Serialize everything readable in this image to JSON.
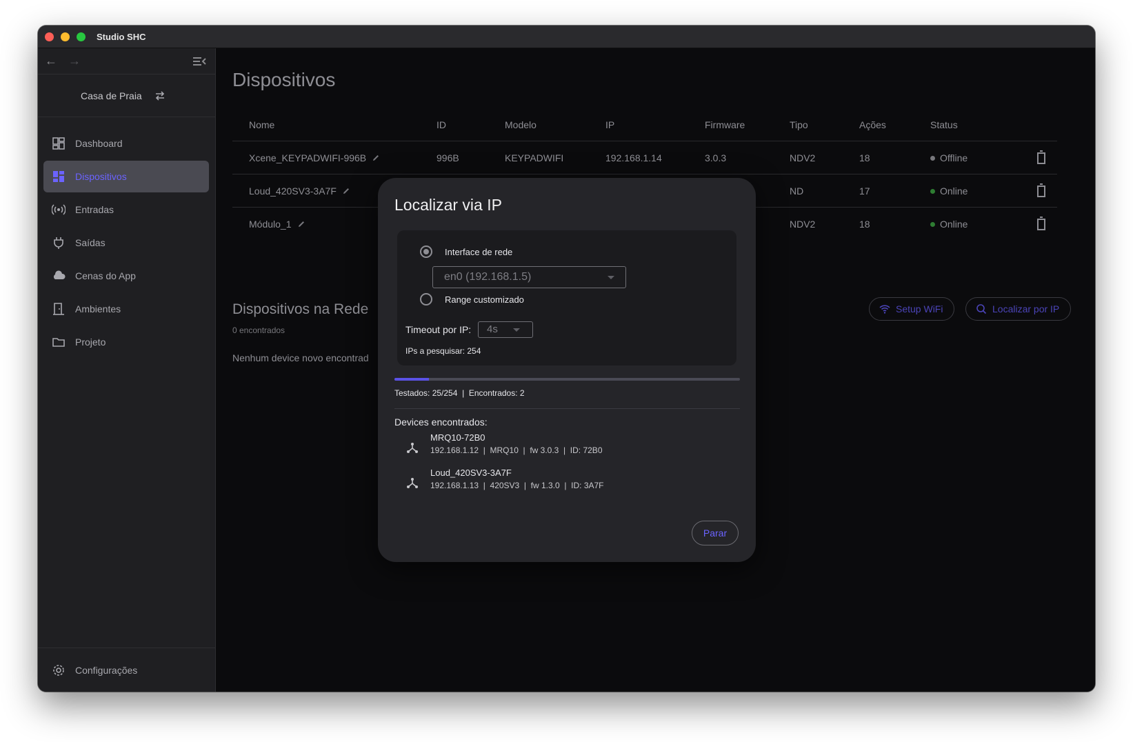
{
  "window": {
    "title": "Studio SHC"
  },
  "sidebar": {
    "house": "Casa de Praia",
    "items": [
      {
        "label": "Dashboard",
        "icon": "dashboard-icon",
        "active": false
      },
      {
        "label": "Dispositivos",
        "icon": "devices-icon",
        "active": true
      },
      {
        "label": "Entradas",
        "icon": "antenna-icon",
        "active": false
      },
      {
        "label": "Saídas",
        "icon": "plug-icon",
        "active": false
      },
      {
        "label": "Cenas do App",
        "icon": "cloud-icon",
        "active": false
      },
      {
        "label": "Ambientes",
        "icon": "door-icon",
        "active": false
      },
      {
        "label": "Projeto",
        "icon": "folder-icon",
        "active": false
      }
    ],
    "settings": "Configurações"
  },
  "main": {
    "title": "Dispositivos",
    "columns": [
      "Nome",
      "ID",
      "Modelo",
      "IP",
      "Firmware",
      "Tipo",
      "Ações",
      "Status"
    ],
    "rows": [
      {
        "nome": "Xcene_KEYPADWIFI-996B",
        "id": "996B",
        "modelo": "KEYPADWIFI",
        "ip": "192.168.1.14",
        "firmware": "3.0.3",
        "tipo": "NDV2",
        "acoes": "18",
        "status": "Offline"
      },
      {
        "nome": "Loud_420SV3-3A7F",
        "id": "",
        "modelo": "",
        "ip": "",
        "firmware": "",
        "tipo": "ND",
        "acoes": "17",
        "status": "Online"
      },
      {
        "nome": "Módulo_1",
        "id": "",
        "modelo": "",
        "ip": "",
        "firmware": "",
        "tipo": "NDV2",
        "acoes": "18",
        "status": "Online"
      }
    ],
    "network": {
      "title": "Dispositivos na Rede",
      "subtitle": "0 encontrados",
      "empty": "Nenhum device novo encontrad",
      "setup_wifi": "Setup WiFi",
      "locate_ip": "Localizar por IP"
    }
  },
  "dialog": {
    "title": "Localizar via IP",
    "option_interface": "Interface de rede",
    "interface_value": "en0 (192.168.1.5)",
    "option_range": "Range customizado",
    "timeout_label": "Timeout por IP:",
    "timeout_value": "4s",
    "ips_to_search": "IPs a pesquisar: 254",
    "progress": 0.1,
    "progress_text": "Testados: 25/254  |  Encontrados: 2",
    "found_title": "Devices encontrados:",
    "devices": [
      {
        "name": "MRQ10-72B0",
        "info": "192.168.1.12  |  MRQ10  |  fw 3.0.3  |  ID: 72B0"
      },
      {
        "name": "Loud_420SV3-3A7F",
        "info": "192.168.1.13  |  420SV3  |  fw 1.3.0  |  ID: 3A7F"
      }
    ],
    "stop": "Parar"
  },
  "colors": {
    "accent": "#6b63ff",
    "online": "#2e7d32",
    "offline": "#77777c",
    "progress": "#5b52e6"
  }
}
